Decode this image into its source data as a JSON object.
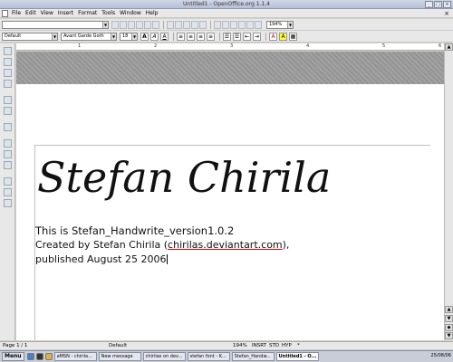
{
  "window": {
    "title": "Untitled1 - OpenOffice.org 1.1.4"
  },
  "menubar": {
    "items": [
      "File",
      "Edit",
      "View",
      "Insert",
      "Format",
      "Tools",
      "Window",
      "Help"
    ]
  },
  "toolbar1": {
    "zoom_value": "194%"
  },
  "toolbar2": {
    "style": "Default",
    "font": "Avant Garde Goth",
    "size": "18"
  },
  "ruler": {
    "ticks": [
      "1",
      "2",
      "3",
      "4",
      "5",
      "6"
    ]
  },
  "document": {
    "signature_text": "Stefan Chirila",
    "line1": "This is Stefan_Handwrite_version1.0.2",
    "line2_prefix": "Created by Stefan Chirila (",
    "line2_link": "chirilas.deviantart.com",
    "line2_suffix": "),",
    "line3": "published August 25 2006"
  },
  "statusbar": {
    "page": "Page 1 / 1",
    "style": "Default",
    "zoom": "194%",
    "insrt": "INSRT",
    "std": "STD",
    "hyp": "HYP",
    "star": "*"
  },
  "taskbar": {
    "menu": "Menu",
    "tasks": [
      "aMSN - chirila...",
      "New message",
      "chirilas on dev...",
      "stefan font - K...",
      "Stefan_Handw...",
      "Untitled1 - O..."
    ],
    "clock": "25/08/06"
  },
  "colors": {
    "highlight": "#ffff33",
    "link_underline": "#cc0000"
  }
}
